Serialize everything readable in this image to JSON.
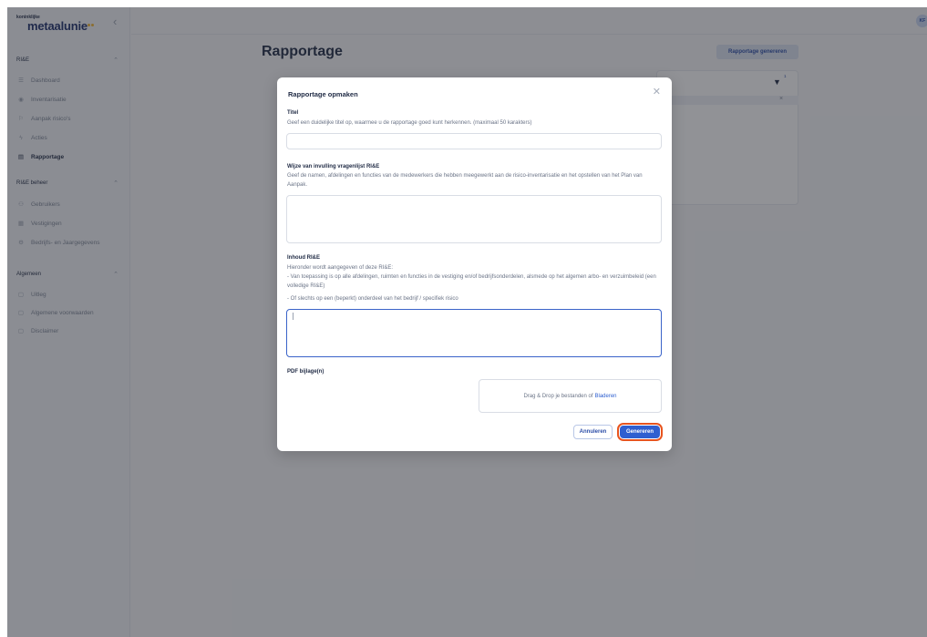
{
  "logo": {
    "small": "koninklijke",
    "main": "metaalunie"
  },
  "avatar": {
    "initials": "KF"
  },
  "sidebar": {
    "sections": [
      {
        "title": "RI&E",
        "items": [
          "Dashboard",
          "Inventarisatie",
          "Aanpak risico's",
          "Acties",
          "Rapportage"
        ]
      },
      {
        "title": "RI&E beheer",
        "items": [
          "Gebruikers",
          "Vestigingen",
          "Bedrijfs- en Jaargegevens"
        ]
      },
      {
        "title": "Algemeen",
        "items": [
          "Uitleg",
          "Algemene voorwaarden",
          "Disclaimer"
        ]
      }
    ],
    "active_item": "Rapportage"
  },
  "page": {
    "title": "Rapportage",
    "generate_button": "Rapportage genereren",
    "filter_count": "1"
  },
  "modal": {
    "title": "Rapportage opmaken",
    "titel_label": "Titel",
    "titel_help": "Geef een duidelijke titel op, waarmee u de rapportage goed kunt herkennen. (maximaal 50 karakters)",
    "titel_value": "",
    "wijze_label": "Wijze van invulling vragenlijst RI&E",
    "wijze_help": "Geef de namen, afdelingen en functies van de medewerkers die hebben meegewerkt aan de risico-inventarisatie en het opstellen van het Plan van Aanpak.",
    "wijze_value": "",
    "inhoud_label": "Inhoud RI&E",
    "inhoud_help_1": "Hieronder wordt aangegeven of deze RI&E:",
    "inhoud_help_2": "- Van toepassing is op alle afdelingen, ruimten en functies in de vestiging en/of bedrijfsonderdelen, alsmede op het algemen arbo- en verzuimbeleid (een volledige RI&E)",
    "inhoud_help_3": "- Of slechts op een (beperkt) onderdeel van het bedrijf / specifiek risico",
    "inhoud_value": "",
    "pdf_label": "PDF bijlage(n)",
    "drop_text": "Drag & Drop je bestanden of",
    "drop_link": "Bladeren",
    "cancel_button": "Annuleren",
    "submit_button": "Genereren"
  },
  "colors": {
    "accent": "#2f5fd0",
    "focus_ring": "#e8541e",
    "overlay": "rgba(35,38,46,0.5)"
  }
}
